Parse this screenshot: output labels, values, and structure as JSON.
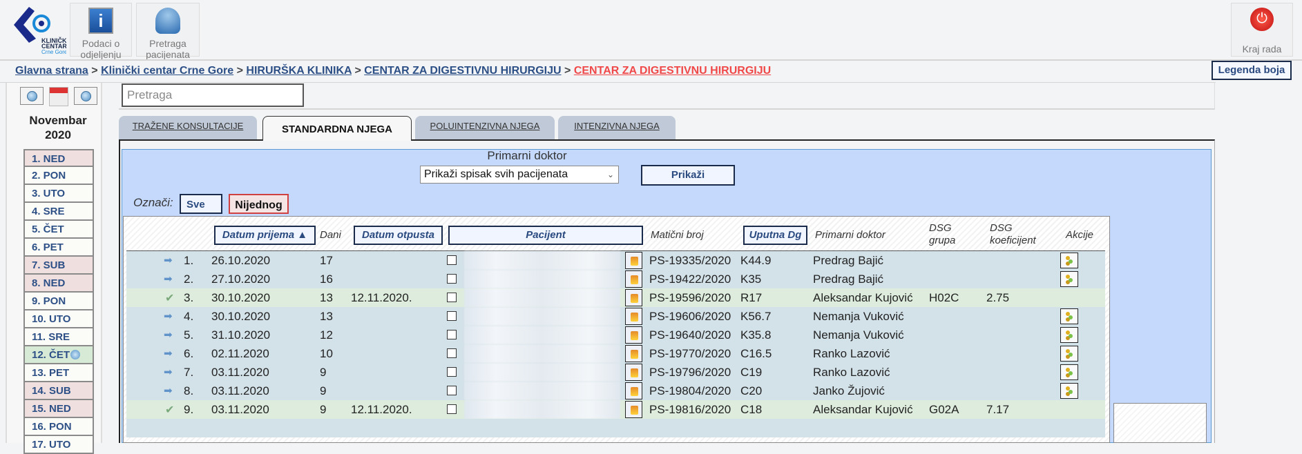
{
  "header": {
    "logo_text": [
      "KLINIČKI",
      "CENTAR",
      "Crne Gore"
    ],
    "buttons": [
      {
        "label": "Podaci o odjeljenju",
        "icon": "info-icon"
      },
      {
        "label": "Pretraga pacijenata",
        "icon": "patient-search-icon"
      },
      {
        "label": "Kraj rada",
        "icon": "power-icon"
      }
    ]
  },
  "breadcrumb": {
    "items": [
      "Glavna strana",
      "Klinički centar Crne Gore",
      "HIRURŠKA KLINIKA",
      "CENTAR ZA DIGESTIVNU HIRURGIJU",
      "CENTAR ZA DIGESTIVNU HIRURGIJU"
    ],
    "sep": ">"
  },
  "legend_label": "Legenda boja",
  "calendar": {
    "month": "Novembar",
    "year": "2020",
    "days": [
      {
        "label": "1. NED",
        "type": "we"
      },
      {
        "label": "2. PON",
        "type": "wd"
      },
      {
        "label": "3. UTO",
        "type": "wd"
      },
      {
        "label": "4. SRE",
        "type": "wd"
      },
      {
        "label": "5. ČET",
        "type": "wd"
      },
      {
        "label": "6. PET",
        "type": "wd"
      },
      {
        "label": "7. SUB",
        "type": "we"
      },
      {
        "label": "8. NED",
        "type": "we"
      },
      {
        "label": "9. PON",
        "type": "wd"
      },
      {
        "label": "10. UTO",
        "type": "wd"
      },
      {
        "label": "11. SRE",
        "type": "wd"
      },
      {
        "label": "12. ČET",
        "type": "today"
      },
      {
        "label": "13. PET",
        "type": "wd"
      },
      {
        "label": "14. SUB",
        "type": "we"
      },
      {
        "label": "15. NED",
        "type": "we"
      },
      {
        "label": "16. PON",
        "type": "wd"
      },
      {
        "label": "17. UTO",
        "type": "wd"
      }
    ]
  },
  "search": {
    "placeholder": "Pretraga",
    "value": ""
  },
  "tabs": [
    {
      "label": "TRAŽENE KONSULTACIJE"
    },
    {
      "label": "STANDARDNA NJEGA",
      "active": true
    },
    {
      "label": "POLUINTENZIVNA NJEGA"
    },
    {
      "label": "INTENZIVNA NJEGA"
    }
  ],
  "filter": {
    "label": "Primarni doktor",
    "selected": "Prikaži spisak svih pacijenata",
    "show_button": "Prikaži",
    "mark_label": "Označi:",
    "all_button": "Sve",
    "none_button": "Nijednog"
  },
  "table": {
    "headers": {
      "admission": "Datum prijema ▲",
      "days": "Dani",
      "discharge": "Datum otpusta",
      "patient": "Pacijent",
      "mb": "Matični broj",
      "dg": "Uputna Dg",
      "doctor": "Primarni doktor",
      "dsg_group": "DSG grupa",
      "dsg_coef": "DSG koeficijent",
      "actions": "Akcije"
    },
    "rows": [
      {
        "num": "1.",
        "date": "26.10.2020",
        "days": "17",
        "discharge": "",
        "mb": "PS-19335/2020",
        "dg": "K44.9",
        "doctor": "Predrag Bajić",
        "dsg_group": "",
        "dsg_coef": "",
        "status": "active",
        "action": true
      },
      {
        "num": "2.",
        "date": "27.10.2020",
        "days": "16",
        "discharge": "",
        "mb": "PS-19422/2020",
        "dg": "K35",
        "doctor": "Predrag Bajić",
        "dsg_group": "",
        "dsg_coef": "",
        "status": "active",
        "action": true
      },
      {
        "num": "3.",
        "date": "30.10.2020",
        "days": "13",
        "discharge": "12.11.2020.",
        "mb": "PS-19596/2020",
        "dg": "R17",
        "doctor": "Aleksandar Kujović",
        "dsg_group": "H02C",
        "dsg_coef": "2.75",
        "status": "discharged",
        "action": false
      },
      {
        "num": "4.",
        "date": "30.10.2020",
        "days": "13",
        "discharge": "",
        "mb": "PS-19606/2020",
        "dg": "K56.7",
        "doctor": "Nemanja Vuković",
        "dsg_group": "",
        "dsg_coef": "",
        "status": "active",
        "action": true
      },
      {
        "num": "5.",
        "date": "31.10.2020",
        "days": "12",
        "discharge": "",
        "mb": "PS-19640/2020",
        "dg": "K35.8",
        "doctor": "Nemanja Vuković",
        "dsg_group": "",
        "dsg_coef": "",
        "status": "active",
        "action": true
      },
      {
        "num": "6.",
        "date": "02.11.2020",
        "days": "10",
        "discharge": "",
        "mb": "PS-19770/2020",
        "dg": "C16.5",
        "doctor": "Ranko Lazović",
        "dsg_group": "",
        "dsg_coef": "",
        "status": "active",
        "action": true
      },
      {
        "num": "7.",
        "date": "03.11.2020",
        "days": "9",
        "discharge": "",
        "mb": "PS-19796/2020",
        "dg": "C19",
        "doctor": "Ranko Lazović",
        "dsg_group": "",
        "dsg_coef": "",
        "status": "active",
        "action": true
      },
      {
        "num": "8.",
        "date": "03.11.2020",
        "days": "9",
        "discharge": "",
        "mb": "PS-19804/2020",
        "dg": "C20",
        "doctor": "Janko Žujović",
        "dsg_group": "",
        "dsg_coef": "",
        "status": "active",
        "action": true
      },
      {
        "num": "9.",
        "date": "03.11.2020",
        "days": "9",
        "discharge": "12.11.2020.",
        "mb": "PS-19816/2020",
        "dg": "C18",
        "doctor": "Aleksandar Kujović",
        "dsg_group": "G02A",
        "dsg_coef": "7.17",
        "status": "discharged",
        "action": false
      }
    ]
  },
  "colors": {
    "link": "#2c4f86",
    "current_crumb": "#f04848",
    "panel": "#c5d9fc",
    "row_active": "#d3e1e8",
    "row_discharged": "#ddecdc"
  }
}
